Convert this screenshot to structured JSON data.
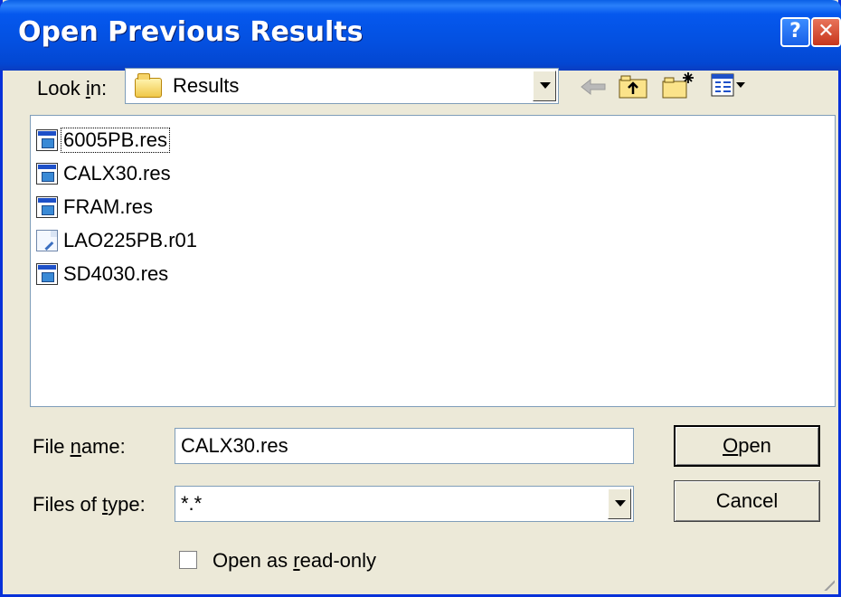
{
  "window": {
    "title": "Open Previous Results",
    "help_label": "?",
    "close_label": "✕"
  },
  "look_in": {
    "label_pre": "Look ",
    "label_key": "i",
    "label_post": "n:",
    "value": "Results"
  },
  "files": [
    {
      "name": "6005PB.res",
      "icon": "results-file-icon"
    },
    {
      "name": "CALX30.res",
      "icon": "results-file-icon"
    },
    {
      "name": "FRAM.res",
      "icon": "results-file-icon"
    },
    {
      "name": "LAO225PB.r01",
      "icon": "document-file-icon"
    },
    {
      "name": "SD4030.res",
      "icon": "results-file-icon"
    }
  ],
  "file_name": {
    "label_pre": "File ",
    "label_key": "n",
    "label_post": "ame:",
    "value": "CALX30.res"
  },
  "file_type": {
    "label_pre": "Files of ",
    "label_key": "t",
    "label_post": "ype:",
    "value": "*.*"
  },
  "buttons": {
    "open_key": "O",
    "open_rest": "pen",
    "cancel": "Cancel"
  },
  "readonly": {
    "label_pre": "Open as ",
    "label_key": "r",
    "label_post": "ead-only",
    "checked": false
  }
}
